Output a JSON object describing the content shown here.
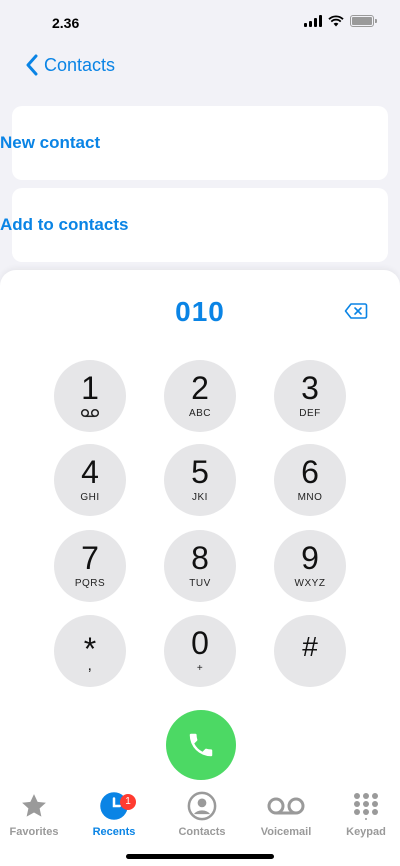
{
  "status_bar": {
    "time": "2.36"
  },
  "nav": {
    "back_label": "Contacts"
  },
  "actions": {
    "new_contact": "New contact",
    "add_to_contacts": "Add to contacts"
  },
  "dialer": {
    "number": "010"
  },
  "keypad": [
    {
      "digit": "1",
      "letters": ""
    },
    {
      "digit": "2",
      "letters": "ABC"
    },
    {
      "digit": "3",
      "letters": "DEF"
    },
    {
      "digit": "4",
      "letters": "GHI"
    },
    {
      "digit": "5",
      "letters": "JKI"
    },
    {
      "digit": "6",
      "letters": "MNO"
    },
    {
      "digit": "7",
      "letters": "PQRS"
    },
    {
      "digit": "8",
      "letters": "TUV"
    },
    {
      "digit": "9",
      "letters": "WXYZ"
    },
    {
      "digit": "*",
      "letters": ","
    },
    {
      "digit": "0",
      "letters": "+"
    },
    {
      "digit": "#",
      "letters": ""
    }
  ],
  "tabs": {
    "favorites": "Favorites",
    "recents": "Recents",
    "recents_badge": "1",
    "contacts": "Contacts",
    "voicemail": "Voicemail",
    "keypad": "Keypad"
  },
  "colors": {
    "accent": "#0a84e5",
    "call": "#4cd964",
    "badge": "#ff3b30",
    "key_bg": "#e6e6e8"
  }
}
